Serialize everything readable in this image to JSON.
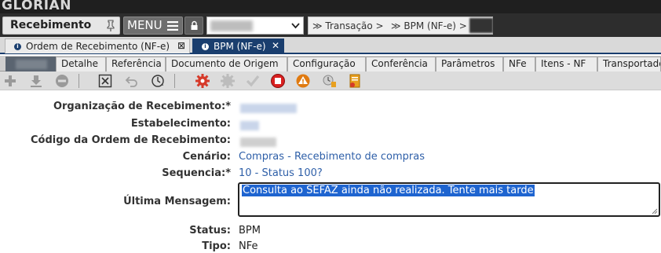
{
  "brand": {
    "logo": "GLORIAN"
  },
  "topbar": {
    "module_label": "Recebimento",
    "menu_label": "MENU",
    "breadcrumb": [
      {
        "label": "≫ Transação >"
      },
      {
        "label": "≫ BPM (NF-e) >"
      }
    ]
  },
  "doc_tabs": [
    {
      "label": "Ordem de Recebimento (NF-e)",
      "close": "⊠",
      "active": false
    },
    {
      "label": "BPM (NF-e)",
      "close": "✕",
      "active": true
    }
  ],
  "form_tabs": [
    {
      "label": "",
      "active": true
    },
    {
      "label": "Detalhe"
    },
    {
      "label": "Referência"
    },
    {
      "label": "Documento de Origem"
    },
    {
      "label": "Configuração"
    },
    {
      "label": "Conferência"
    },
    {
      "label": "Parâmetros"
    },
    {
      "label": "NFe"
    },
    {
      "label": "Itens - NF"
    },
    {
      "label": "Transportador"
    }
  ],
  "toolbar": {
    "icons": [
      "add-icon",
      "download-icon",
      "remove-icon",
      "close-window-icon",
      "undo-icon",
      "refresh-icon",
      "settings-gear-icon",
      "disabled-gear-icon",
      "check-icon",
      "stop-icon",
      "warning-icon",
      "history-icon",
      "report-icon"
    ]
  },
  "form": {
    "org_label": "Organização de Recebimento:*",
    "estab_label": "Estabelecimento:",
    "codigo_label": "Código da Ordem de Recebimento:",
    "cenario_label": "Cenário:",
    "cenario_value": "Compras - Recebimento de compras",
    "sequencia_label": "Sequencia:*",
    "sequencia_value": "10 - Status 100?",
    "ultima_label": "Última Mensagem:",
    "ultima_value": "Consulta ao SEFAZ ainda não realizada. Tente mais tarde",
    "status_label": "Status:",
    "status_value": "BPM",
    "tipo_label": "Tipo:",
    "tipo_value": "NFe"
  },
  "colors": {
    "topbar": "#2d2d2d",
    "active_tab": "#1a3e6e",
    "link": "#2e5fa8",
    "selection": "#1e64d0"
  }
}
